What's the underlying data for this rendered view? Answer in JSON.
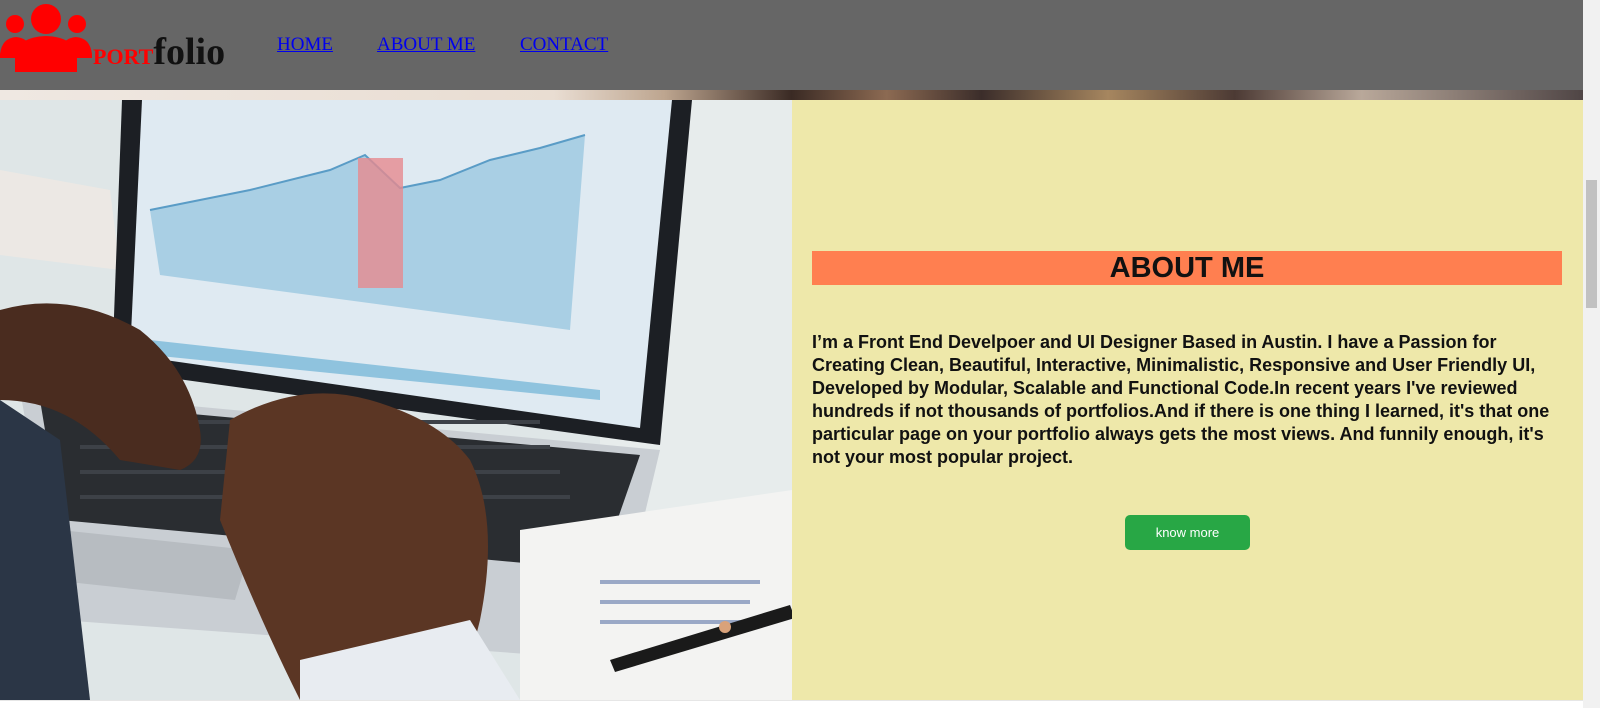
{
  "header": {
    "logo": {
      "icon": "users-group-icon",
      "part1": "PORT",
      "part2": "folio"
    },
    "nav": [
      {
        "label": "HOME"
      },
      {
        "label": "ABOUT ME"
      },
      {
        "label": "CONTACT"
      }
    ]
  },
  "hero_image": {
    "icon": "laptop-analytics-photo"
  },
  "about": {
    "title": "ABOUT ME",
    "text": "I’m a Front End Develpoer and UI Designer Based in Austin. I have a Passion for Creating Clean, Beautiful, Interactive, Minimalistic, Responsive and User Friendly UI, Developed by Modular, Scalable and Functional Code.In recent years I've reviewed hundreds if not thousands of portfolios.And if there is one thing I learned, it's that one particular page on your portfolio always gets the most views. And funnily enough, it's not your most popular project.",
    "button": "know more"
  },
  "colors": {
    "header_bg": "#666666",
    "logo_red": "#ff0000",
    "panel_bg": "#eee8aa",
    "title_bg": "#ff7f50",
    "button_bg": "#28a745"
  }
}
